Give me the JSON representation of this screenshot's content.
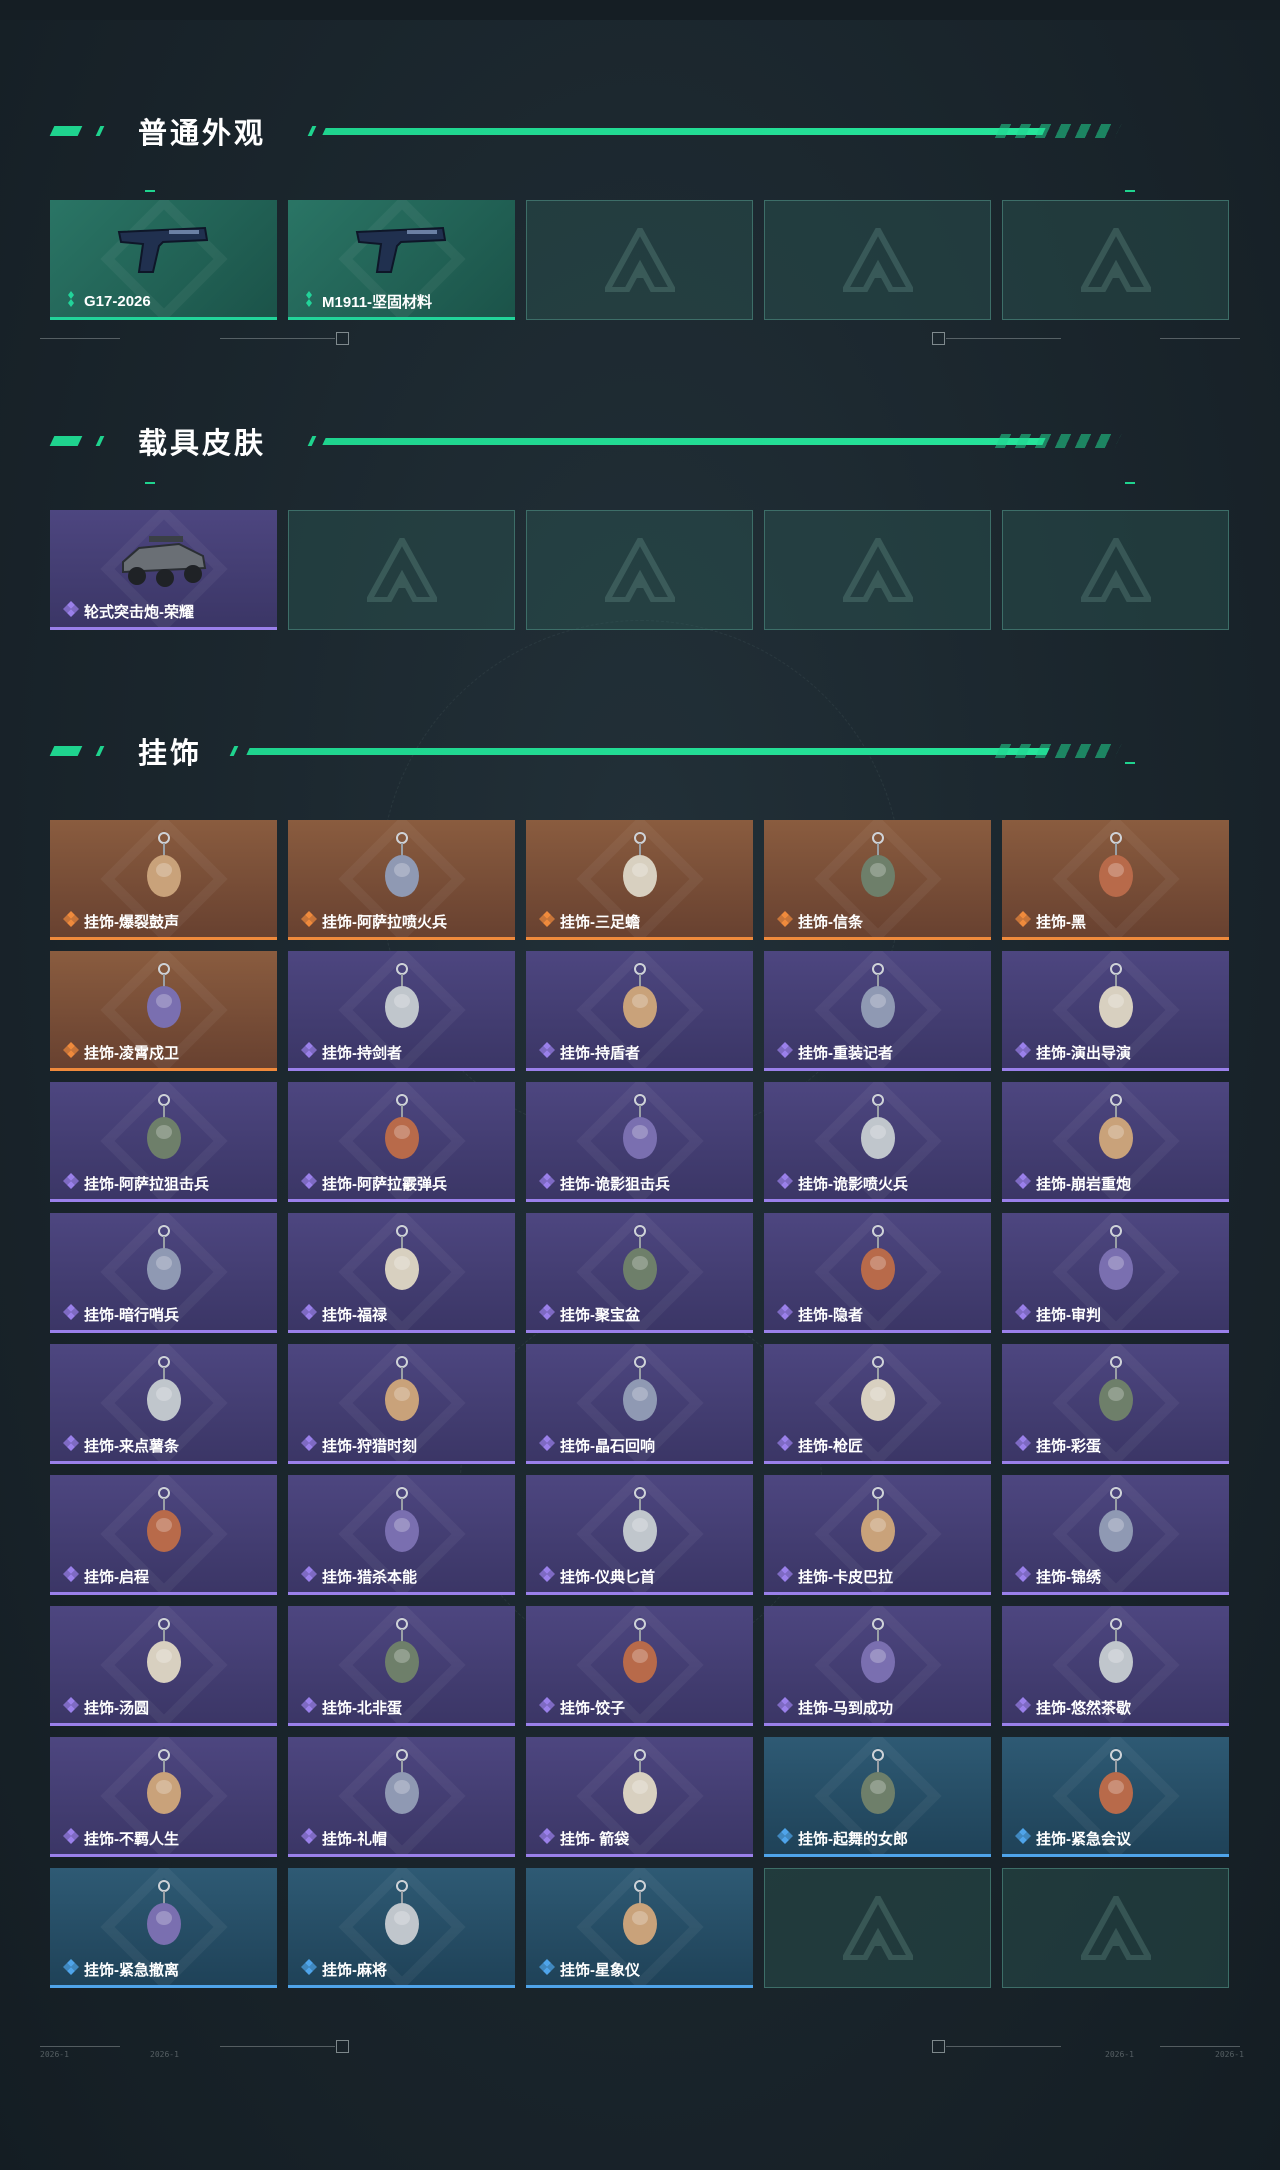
{
  "sections": [
    {
      "title": "普通外观",
      "items": [
        {
          "label": "G17-2026",
          "rarity": "green",
          "icon": "pistol-icon"
        },
        {
          "label": "M1911-坚固材料",
          "rarity": "green",
          "icon": "pistol-icon"
        },
        {
          "label": "",
          "rarity": "empty",
          "icon": ""
        },
        {
          "label": "",
          "rarity": "empty",
          "icon": ""
        },
        {
          "label": "",
          "rarity": "empty",
          "icon": ""
        }
      ]
    },
    {
      "title": "载具皮肤",
      "items": [
        {
          "label": "轮式突击炮-荣耀",
          "rarity": "purple",
          "icon": "vehicle-icon"
        },
        {
          "label": "",
          "rarity": "empty",
          "icon": ""
        },
        {
          "label": "",
          "rarity": "empty",
          "icon": ""
        },
        {
          "label": "",
          "rarity": "empty",
          "icon": ""
        },
        {
          "label": "",
          "rarity": "empty",
          "icon": ""
        }
      ]
    },
    {
      "title": "挂饰",
      "items": [
        {
          "label": "挂饰-爆裂鼓声",
          "rarity": "orange",
          "icon": "charm-icon"
        },
        {
          "label": "挂饰-阿萨拉喷火兵",
          "rarity": "orange",
          "icon": "charm-icon"
        },
        {
          "label": "挂饰-三足蟾",
          "rarity": "orange",
          "icon": "charm-icon"
        },
        {
          "label": "挂饰-信条",
          "rarity": "orange",
          "icon": "charm-icon"
        },
        {
          "label": "挂饰-黑",
          "rarity": "orange",
          "icon": "charm-icon"
        },
        {
          "label": "挂饰-凌霄戍卫",
          "rarity": "orange",
          "icon": "charm-icon"
        },
        {
          "label": "挂饰-持剑者",
          "rarity": "purple",
          "icon": "charm-icon"
        },
        {
          "label": "挂饰-持盾者",
          "rarity": "purple",
          "icon": "charm-icon"
        },
        {
          "label": "挂饰-重装记者",
          "rarity": "purple",
          "icon": "charm-icon"
        },
        {
          "label": "挂饰-演出导演",
          "rarity": "purple",
          "icon": "charm-icon"
        },
        {
          "label": "挂饰-阿萨拉狙击兵",
          "rarity": "purple",
          "icon": "charm-icon"
        },
        {
          "label": "挂饰-阿萨拉霰弹兵",
          "rarity": "purple",
          "icon": "charm-icon"
        },
        {
          "label": "挂饰-诡影狙击兵",
          "rarity": "purple",
          "icon": "charm-icon"
        },
        {
          "label": "挂饰-诡影喷火兵",
          "rarity": "purple",
          "icon": "charm-icon"
        },
        {
          "label": "挂饰-崩岩重炮",
          "rarity": "purple",
          "icon": "charm-icon"
        },
        {
          "label": "挂饰-暗行哨兵",
          "rarity": "purple",
          "icon": "charm-icon"
        },
        {
          "label": "挂饰-福禄",
          "rarity": "purple",
          "icon": "charm-icon"
        },
        {
          "label": "挂饰-聚宝盆",
          "rarity": "purple",
          "icon": "charm-icon"
        },
        {
          "label": "挂饰-隐者",
          "rarity": "purple",
          "icon": "charm-icon"
        },
        {
          "label": "挂饰-审判",
          "rarity": "purple",
          "icon": "charm-icon"
        },
        {
          "label": "挂饰-来点薯条",
          "rarity": "purple",
          "icon": "charm-icon"
        },
        {
          "label": "挂饰-狩猎时刻",
          "rarity": "purple",
          "icon": "charm-icon"
        },
        {
          "label": "挂饰-晶石回响",
          "rarity": "purple",
          "icon": "charm-icon"
        },
        {
          "label": "挂饰-枪匠",
          "rarity": "purple",
          "icon": "charm-icon"
        },
        {
          "label": "挂饰-彩蛋",
          "rarity": "purple",
          "icon": "charm-icon"
        },
        {
          "label": "挂饰-启程",
          "rarity": "purple",
          "icon": "charm-icon"
        },
        {
          "label": "挂饰-猎杀本能",
          "rarity": "purple",
          "icon": "charm-icon"
        },
        {
          "label": "挂饰-仪典匕首",
          "rarity": "purple",
          "icon": "charm-icon"
        },
        {
          "label": "挂饰-卡皮巴拉",
          "rarity": "purple",
          "icon": "charm-icon"
        },
        {
          "label": "挂饰-锦绣",
          "rarity": "purple",
          "icon": "charm-icon"
        },
        {
          "label": "挂饰-汤圆",
          "rarity": "purple",
          "icon": "charm-icon"
        },
        {
          "label": "挂饰-北非蛋",
          "rarity": "purple",
          "icon": "charm-icon"
        },
        {
          "label": "挂饰-饺子",
          "rarity": "purple",
          "icon": "charm-icon"
        },
        {
          "label": "挂饰-马到成功",
          "rarity": "purple",
          "icon": "charm-icon"
        },
        {
          "label": "挂饰-悠然茶歇",
          "rarity": "purple",
          "icon": "charm-icon"
        },
        {
          "label": "挂饰-不羁人生",
          "rarity": "purple",
          "icon": "charm-icon"
        },
        {
          "label": "挂饰-礼帽",
          "rarity": "purple",
          "icon": "charm-icon"
        },
        {
          "label": "挂饰- 箭袋",
          "rarity": "purple",
          "icon": "charm-icon"
        },
        {
          "label": "挂饰-起舞的女郎",
          "rarity": "blue",
          "icon": "charm-icon"
        },
        {
          "label": "挂饰-紧急会议",
          "rarity": "blue",
          "icon": "charm-icon"
        },
        {
          "label": "挂饰-紧急撤离",
          "rarity": "blue",
          "icon": "charm-icon"
        },
        {
          "label": "挂饰-麻将",
          "rarity": "blue",
          "icon": "charm-icon"
        },
        {
          "label": "挂饰-星象仪",
          "rarity": "blue",
          "icon": "charm-icon"
        },
        {
          "label": "",
          "rarity": "empty",
          "icon": ""
        },
        {
          "label": "",
          "rarity": "empty",
          "icon": ""
        }
      ]
    }
  ],
  "frame_marks": [
    "2026-1",
    "2026-1",
    "2026-1",
    "2026-1"
  ],
  "colors": {
    "accent": "#1fd38e",
    "green": "#22d49a",
    "purple": "#9a80ea",
    "orange": "#ef8a3c",
    "blue": "#4fa4ea"
  }
}
